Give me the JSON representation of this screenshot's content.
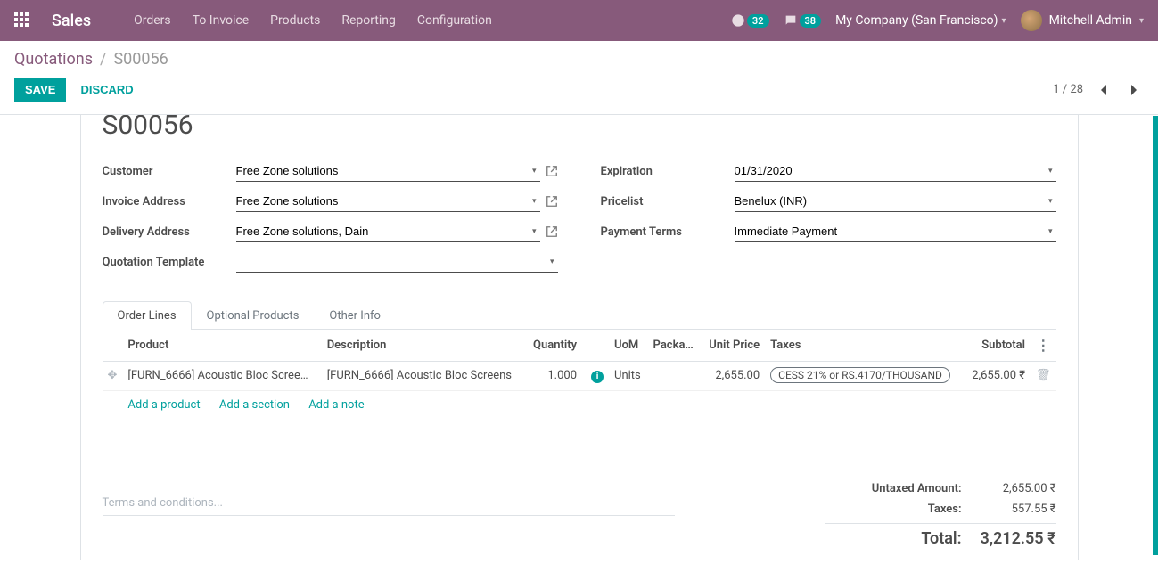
{
  "nav": {
    "brand": "Sales",
    "items": [
      "Orders",
      "To Invoice",
      "Products",
      "Reporting",
      "Configuration"
    ],
    "badge_timer": "32",
    "badge_chat": "38",
    "company": "My Company (San Francisco)",
    "user": "Mitchell Admin"
  },
  "breadcrumb": {
    "parent": "Quotations",
    "current": "S00056"
  },
  "actions": {
    "save": "SAVE",
    "discard": "DISCARD",
    "pager": "1 / 28"
  },
  "record": {
    "title": "S00056",
    "left": {
      "customer_label": "Customer",
      "customer": "Free Zone solutions",
      "invoice_addr_label": "Invoice Address",
      "invoice_addr": "Free Zone solutions",
      "delivery_addr_label": "Delivery Address",
      "delivery_addr": "Free Zone solutions, Dain",
      "template_label": "Quotation Template",
      "template": ""
    },
    "right": {
      "expiration_label": "Expiration",
      "expiration": "01/31/2020",
      "pricelist_label": "Pricelist",
      "pricelist": "Benelux (INR)",
      "payment_terms_label": "Payment Terms",
      "payment_terms": "Immediate Payment"
    }
  },
  "tabs": [
    "Order Lines",
    "Optional Products",
    "Other Info"
  ],
  "lines": {
    "headers": {
      "product": "Product",
      "description": "Description",
      "quantity": "Quantity",
      "uom": "UoM",
      "package": "Packa…",
      "unit_price": "Unit Price",
      "taxes": "Taxes",
      "subtotal": "Subtotal"
    },
    "rows": [
      {
        "product": "[FURN_6666] Acoustic Bloc Scree…",
        "description": "[FURN_6666] Acoustic Bloc Screens",
        "quantity": "1.000",
        "uom": "Units",
        "package": "",
        "unit_price": "2,655.00",
        "taxes": "CESS 21% or RS.4170/THOUSAND",
        "subtotal": "2,655.00 ₹"
      }
    ],
    "add_product": "Add a product",
    "add_section": "Add a section",
    "add_note": "Add a note"
  },
  "terms_placeholder": "Terms and conditions...",
  "totals": {
    "untaxed_label": "Untaxed Amount:",
    "untaxed": "2,655.00 ₹",
    "taxes_label": "Taxes:",
    "taxes": "557.55 ₹",
    "total_label": "Total:",
    "total": "3,212.55 ₹"
  }
}
